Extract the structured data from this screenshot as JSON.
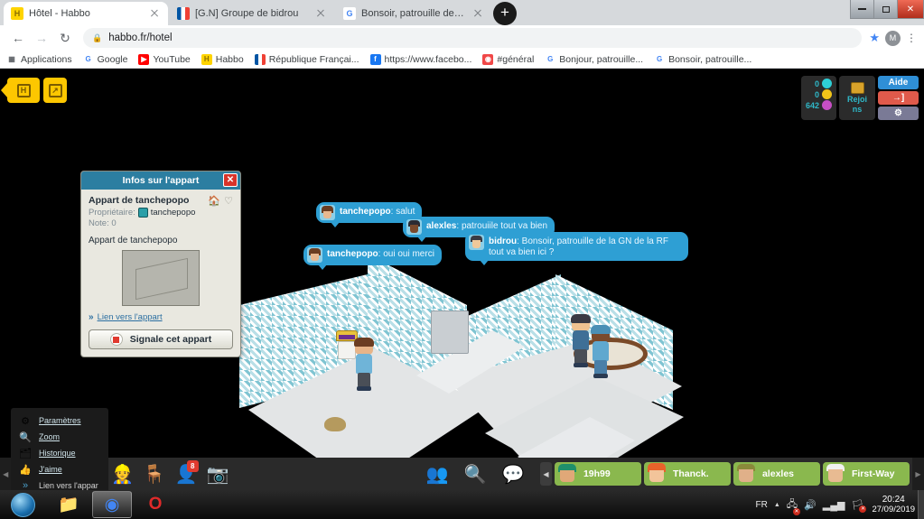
{
  "browser": {
    "tabs": [
      {
        "title": "Hôtel - Habbo",
        "favicon": "habbo-icon",
        "active": true
      },
      {
        "title": "[G.N] Groupe de bidrou",
        "favicon": "france-flag-icon",
        "active": false
      },
      {
        "title": "Bonsoir, patrouille de la GN de la",
        "favicon": "google-icon",
        "active": false
      }
    ],
    "new_tab_label": "+",
    "window_controls": {
      "minimize": "—",
      "maximize": "❐",
      "close": "✕"
    },
    "nav": {
      "back": "←",
      "forward": "→",
      "reload": "↻"
    },
    "omnibox": {
      "lock": "🔒",
      "url": "habbo.fr/hotel"
    },
    "star_label": "★",
    "profile_initial": "M",
    "menu_label": "⋮",
    "bookmarks": [
      {
        "label": "Applications",
        "icon": "apps-grid-icon"
      },
      {
        "label": "Google",
        "icon": "google-icon"
      },
      {
        "label": "YouTube",
        "icon": "youtube-icon"
      },
      {
        "label": "Habbo",
        "icon": "habbo-icon"
      },
      {
        "label": "République Françai...",
        "icon": "france-flag-icon"
      },
      {
        "label": "https://www.facebo...",
        "icon": "facebook-icon"
      },
      {
        "label": "#général",
        "icon": "discord-icon"
      },
      {
        "label": "Bonjour, patrouille...",
        "icon": "google-icon"
      },
      {
        "label": "Bonsoir, patrouille...",
        "icon": "google-icon"
      }
    ]
  },
  "game": {
    "top_left": {
      "home_label": "H",
      "expand_label": "↗"
    },
    "hud": {
      "purses": [
        {
          "value": "0",
          "currency": "diamonds"
        },
        {
          "value": "0",
          "currency": "credits"
        },
        {
          "value": "642",
          "currency": "duckets"
        }
      ],
      "join_label_line1": "Rejoi",
      "join_label_line2": "ns",
      "buttons": [
        {
          "label": "Aide",
          "name": "help-button"
        },
        {
          "label": "→]",
          "name": "logout-button"
        },
        {
          "label": "⚙",
          "name": "settings-button"
        }
      ]
    },
    "room_panel": {
      "title": "Infos sur l'appart",
      "close_label": "✕",
      "room_name": "Appart de tanchepopo",
      "owner_label": "Propriétaire:",
      "owner_name": "tanchepopo",
      "rating_label": "Note:",
      "rating_value": "0",
      "description": "Appart de tanchepopo",
      "link_label": "Lien vers l'appart",
      "link_chevron": "»",
      "report_label": "Signale cet appart",
      "home_icon_label": "🏠",
      "favorite_icon_label": "♡"
    },
    "context_menu": {
      "items": [
        {
          "label": "Paramètres",
          "icon": "gear-icon"
        },
        {
          "label": "Zoom",
          "icon": "magnifier-icon"
        },
        {
          "label": "Historique",
          "icon": "history-icon"
        },
        {
          "label": "J'aime",
          "icon": "thumbs-up-icon"
        },
        {
          "label": "Lien vers l'appar",
          "icon": "chevrons-right-icon"
        }
      ],
      "back_arrow": "◀",
      "forward_arrow": "▶",
      "thumb_icon": "room-thumb-icon"
    },
    "chat_bubbles": [
      {
        "user": "tanchepopo",
        "text": "salut",
        "avatar": "avatar-brown-hair"
      },
      {
        "user": "alexles",
        "text": "patrouiile tout va bien",
        "avatar": "avatar-dark-skin"
      },
      {
        "user": "bidrou",
        "text": "Bonsoir, patrouille de la GN de la RF tout va bien ici ?",
        "avatar": "avatar-blond"
      },
      {
        "user": "tanchepopo",
        "text": "oui oui merci",
        "avatar": "avatar-brown-hair"
      }
    ],
    "chat_input": {
      "placeholder": "",
      "value": "",
      "style_icon": "chat-bubble-style-icon"
    },
    "toolbar_icons": [
      {
        "name": "habbo-home-icon",
        "glyph": "🏠"
      },
      {
        "name": "rooms-icon",
        "glyph": "⬢"
      },
      {
        "name": "catalog-icon",
        "glyph": "🛒"
      },
      {
        "name": "builders-club-icon",
        "glyph": "👷"
      },
      {
        "name": "inventory-icon",
        "glyph": "🪑"
      },
      {
        "name": "profile-icon",
        "glyph": "👤",
        "badge": "8"
      },
      {
        "name": "camera-icon",
        "glyph": "📷"
      },
      {
        "name": "friends-group-icon",
        "glyph": "👥"
      },
      {
        "name": "friend-search-icon",
        "glyph": "🔍"
      },
      {
        "name": "messages-icon",
        "glyph": "💬"
      }
    ],
    "friends": [
      {
        "name": "19h99",
        "face": "face-green-hair"
      },
      {
        "name": "Thanck.",
        "face": "face-orange-hair"
      },
      {
        "name": "alexles",
        "face": "face-olive-cap"
      },
      {
        "name": "First-Way",
        "face": "face-white-cap"
      }
    ],
    "friend_nav": {
      "prev": "◀",
      "next": "▶"
    },
    "grip_left": "◀",
    "grip_right": "▶"
  },
  "taskbar": {
    "start_label": "Start",
    "apps": [
      {
        "name": "file-explorer-icon",
        "glyph": "📁",
        "active": false
      },
      {
        "name": "chrome-icon",
        "glyph": "◉",
        "active": true
      },
      {
        "name": "opera-icon",
        "glyph": "O",
        "active": false
      }
    ],
    "tray": {
      "language": "FR",
      "expand": "▲",
      "icons": [
        {
          "name": "network-error-icon",
          "glyph": "🖧"
        },
        {
          "name": "volume-icon",
          "glyph": "🔊"
        },
        {
          "name": "signal-icon",
          "glyph": "▂▄▆"
        },
        {
          "name": "action-center-icon",
          "glyph": "🏳"
        }
      ],
      "time": "20:24",
      "date": "27/09/2019"
    }
  }
}
